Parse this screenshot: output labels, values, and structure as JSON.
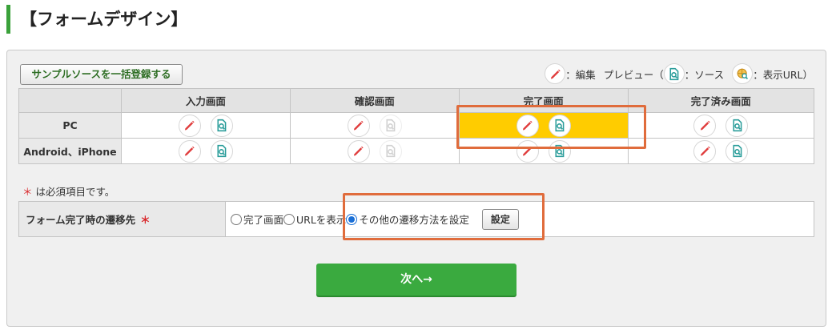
{
  "page_title": "【フォームデザイン】",
  "bulk_button": "サンプルソースを一括登録する",
  "legend": {
    "edit": "：編集",
    "preview_prefix": "プレビュー（",
    "source": "：ソース",
    "url": "：表示URL）"
  },
  "table": {
    "columns": [
      "入力画面",
      "確認画面",
      "完了画面",
      "完了済み画面"
    ],
    "rows": [
      {
        "label": "PC",
        "cells": [
          {
            "edit": true,
            "preview_active": true
          },
          {
            "edit": true,
            "preview_active": false
          },
          {
            "edit": true,
            "preview_active": true,
            "highlight": true
          },
          {
            "edit": true,
            "preview_active": true
          }
        ]
      },
      {
        "label": "Android、iPhone",
        "cells": [
          {
            "edit": true,
            "preview_active": true
          },
          {
            "edit": true,
            "preview_active": false
          },
          {
            "edit": true,
            "preview_active": true
          },
          {
            "edit": true,
            "preview_active": true
          }
        ]
      }
    ]
  },
  "required_note": {
    "star": "＊",
    "text": "は必須項目です。"
  },
  "destination": {
    "label": "フォーム完了時の遷移先",
    "star": "＊",
    "options": [
      {
        "label": "完了画面",
        "checked": false
      },
      {
        "label": "URLを表示",
        "checked": false
      },
      {
        "label": "その他の遷移方法を設定",
        "checked": true
      }
    ],
    "settings_button": "設定"
  },
  "next_button": "次へ→",
  "colors": {
    "accent_green": "#3aaa3f",
    "highlight": "#ffcc00",
    "callout": "#e06c3c",
    "edit_red": "#e03c3c",
    "preview_teal": "#2a9d9a"
  }
}
